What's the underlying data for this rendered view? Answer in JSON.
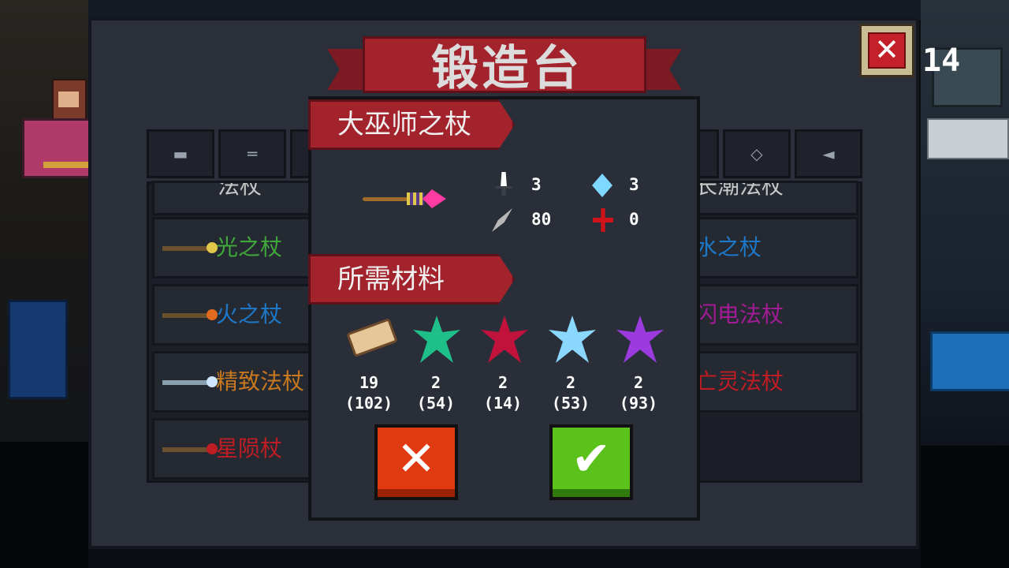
{
  "window": {
    "title": "锻造台",
    "close_label": "✕",
    "counter": "14"
  },
  "tabs": [
    {
      "icon": "pistol-icon"
    },
    {
      "icon": "rifle-icon"
    },
    {
      "icon": "weapon-icon"
    },
    {
      "icon": "gun-icon"
    },
    {
      "icon": "shuriken-icon"
    },
    {
      "icon": "fish-icon"
    }
  ],
  "list": {
    "left_items": [
      {
        "label": "法杖",
        "color": "#c8c8c8",
        "partial": true
      },
      {
        "label": "光之杖",
        "color": "#3fa83a"
      },
      {
        "label": "火之杖",
        "color": "#1e78c8"
      },
      {
        "label": "精致法杖",
        "color": "#c8781e"
      },
      {
        "label": "星陨杖",
        "color": "#c01c24"
      }
    ],
    "right_items": [
      {
        "label": "长潮法杖",
        "color": "#c8c8c8",
        "partial": true
      },
      {
        "label": "水之杖",
        "color": "#1e78c8"
      },
      {
        "label": "闪电法杖",
        "color": "#a21c96"
      },
      {
        "label": "亡灵法杖",
        "color": "#c01c24"
      }
    ]
  },
  "modal": {
    "item_name": "大巫师之杖",
    "stats": {
      "damage": "3",
      "energy": "3",
      "crit": "80",
      "accuracy": "0"
    },
    "materials_title": "所需材料",
    "materials": [
      {
        "name": "log",
        "color": "#e6c79a",
        "need": "19",
        "have": "(102)"
      },
      {
        "name": "green-crystal",
        "color": "#1fbf8a",
        "need": "2",
        "have": "(54)"
      },
      {
        "name": "red-crystal",
        "color": "#c0123a",
        "need": "2",
        "have": "(14)"
      },
      {
        "name": "blue-crystal",
        "color": "#8ad8ff",
        "need": "2",
        "have": "(53)"
      },
      {
        "name": "purple-crystal",
        "color": "#9a3adf",
        "need": "2",
        "have": "(93)"
      }
    ],
    "cancel_label": "✕",
    "confirm_label": "✔"
  }
}
